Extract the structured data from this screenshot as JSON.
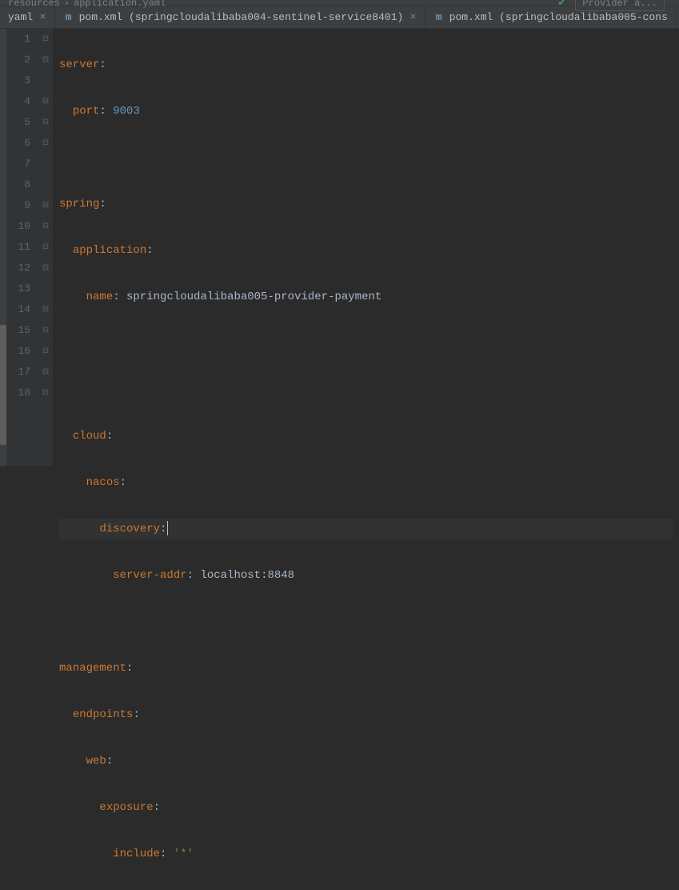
{
  "breadcrumb": {
    "folder": "resources",
    "file": "application.yaml"
  },
  "topRight": {
    "provider": "Provider a..."
  },
  "tabs": [
    {
      "label": "yaml",
      "close": "×"
    },
    {
      "label": "pom.xml (springcloudalibaba004-sentinel-service8401)",
      "close": "×",
      "icon": "m"
    },
    {
      "label": "pom.xml (springcloudalibaba005-cons",
      "icon": "m"
    }
  ],
  "lineNumbers": [
    "1",
    "2",
    "3",
    "4",
    "5",
    "6",
    "7",
    "8",
    "9",
    "10",
    "11",
    "12",
    "13",
    "14",
    "15",
    "16",
    "17",
    "18"
  ],
  "code": {
    "l1_key": "server",
    "l2_key": "port",
    "l2_val": "9003",
    "l4_key": "spring",
    "l5_key": "application",
    "l6_key": "name",
    "l6_val": "springcloudalibaba005-provider-payment",
    "l9_key": "cloud",
    "l10_key": "nacos",
    "l11_key": "discovery",
    "l12_key": "server-addr",
    "l12_val": "localhost:8848",
    "l14_key": "management",
    "l15_key": "endpoints",
    "l16_key": "web",
    "l17_key": "exposure",
    "l18_key": "include",
    "l18_val": "'*'"
  }
}
